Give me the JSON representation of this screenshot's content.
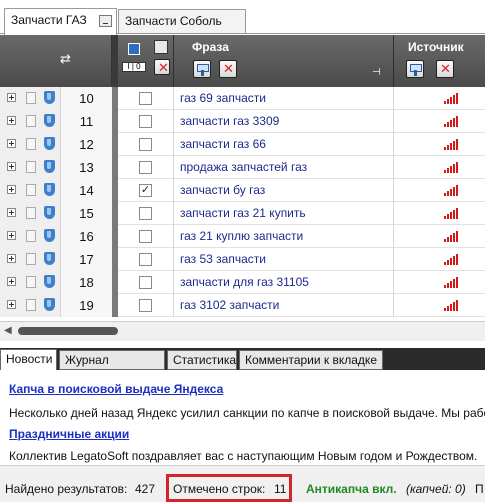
{
  "tabs": [
    {
      "label": "Запчасти ГАЗ",
      "active": true
    },
    {
      "label": "Запчасти Соболь",
      "active": false
    }
  ],
  "grid": {
    "col_phrase": "Фраза",
    "col_source": "Источник",
    "rows": [
      {
        "num": "10",
        "checked": false,
        "phrase": "газ 69 запчасти"
      },
      {
        "num": "11",
        "checked": false,
        "phrase": "запчасти газ 3309"
      },
      {
        "num": "12",
        "checked": false,
        "phrase": "запчасти газ 66"
      },
      {
        "num": "13",
        "checked": false,
        "phrase": "продажа запчастей газ"
      },
      {
        "num": "14",
        "checked": true,
        "phrase": "запчасти бу газ"
      },
      {
        "num": "15",
        "checked": false,
        "phrase": "запчасти газ 21 купить"
      },
      {
        "num": "16",
        "checked": false,
        "phrase": "газ 21 куплю запчасти"
      },
      {
        "num": "17",
        "checked": false,
        "phrase": "газ 53 запчасти"
      },
      {
        "num": "18",
        "checked": false,
        "phrase": "запчасти для газ 31105"
      },
      {
        "num": "19",
        "checked": false,
        "phrase": "газ 3102 запчасти"
      }
    ]
  },
  "bottom_tabs": [
    "Новости",
    "Журнал событий",
    "Статистика",
    "Комментарии к вкладке"
  ],
  "news": [
    {
      "title": "Капча в поисковой выдаче Яндекса",
      "text": "Несколько дней назад Яндекс усилил санкции по капче в поисковой выдаче. Мы рабо"
    },
    {
      "title": "Праздничные акции",
      "text": "Коллектив LegatoSoft поздравляет вас с наступающим Новым годом и Рождеством."
    }
  ],
  "status": {
    "found_label": "Найдено результатов:",
    "found_value": "427",
    "marked_label": "Отмечено строк:",
    "marked_value": "11",
    "anticaptcha": "Антикапча вкл.",
    "captcha_count": "(капчей: 0)",
    "pause": "П"
  },
  "colors": {
    "accent_red": "#d0262a",
    "link_blue": "#1b2fc2",
    "phrase_blue": "#1b2a8c",
    "green": "#1f8a1f"
  }
}
